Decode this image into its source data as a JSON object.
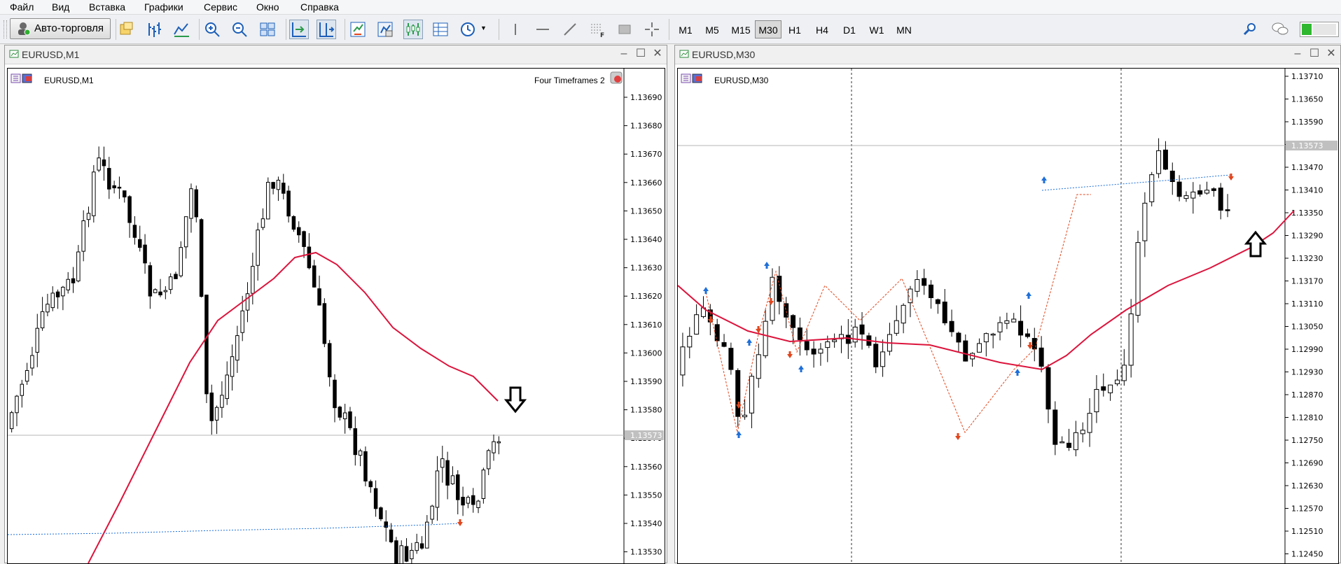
{
  "menu": [
    "Файл",
    "Вид",
    "Вставка",
    "Графики",
    "Сервис",
    "Окно",
    "Справка"
  ],
  "toolbar": {
    "auto_trading_label": "Авто-торговля",
    "timeframes": [
      "M1",
      "M5",
      "M15",
      "M30",
      "H1",
      "H4",
      "D1",
      "W1",
      "MN"
    ],
    "active_timeframe": "M30",
    "icons": [
      "new-chart-icon",
      "profiles-icon",
      "bar-chart-icon",
      "line-chart-icon",
      "zoom-in-icon",
      "zoom-out-icon",
      "tile-windows-icon",
      "autoscroll-icon",
      "chart-shift-icon",
      "indicators-icon",
      "templates-icon",
      "period-separators-icon",
      "grid-icon",
      "clock-icon",
      "vertical-line-icon",
      "horizontal-line-icon",
      "trendline-icon",
      "fibonacci-icon",
      "rectangle-icon",
      "crosshair-icon",
      "search-icon",
      "chat-icon",
      "connection-status-icon"
    ]
  },
  "windows": [
    {
      "title": "EURUSD,M1",
      "symbol_label": "EURUSD,M1",
      "indicator_label": "Four Timeframes 2",
      "price_tag": "1.13573",
      "price_ticks": [
        "1.13690",
        "1.13680",
        "1.13670",
        "1.13660",
        "1.13650",
        "1.13640",
        "1.13630",
        "1.13620",
        "1.13610",
        "1.13600",
        "1.13590",
        "1.13580",
        "1.13570",
        "1.13560",
        "1.13550",
        "1.13540",
        "1.13530"
      ],
      "arrow": "down"
    },
    {
      "title": "EURUSD,M30",
      "symbol_label": "EURUSD,M30",
      "indicator_label": "",
      "price_tag": "1.13573",
      "price_ticks": [
        "1.13710",
        "1.13650",
        "1.13590",
        "1.13530",
        "1.13470",
        "1.13410",
        "1.13350",
        "1.13290",
        "1.13230",
        "1.13170",
        "1.13110",
        "1.13050",
        "1.12990",
        "1.12930",
        "1.12870",
        "1.12810",
        "1.12750",
        "1.12690",
        "1.12630",
        "1.12570",
        "1.12510",
        "1.12450"
      ],
      "arrow": "up"
    }
  ],
  "colors": {
    "ma_line": "#dc143c",
    "dotted_line": "#1e6fd9",
    "buy_arrow": "#1e6fd9",
    "sell_arrow": "#e2451c",
    "bull_candle": "#ffffff",
    "bear_candle": "#000000"
  }
}
